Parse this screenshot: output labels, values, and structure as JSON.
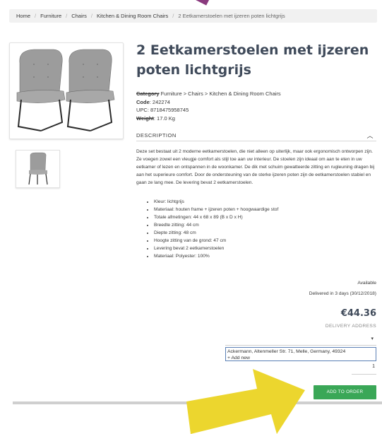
{
  "breadcrumb": {
    "items": [
      "Home",
      "Furniture",
      "Chairs",
      "Kitchen & Dining Room Chairs"
    ],
    "current": "2 Eetkamerstoelen met ijzeren poten lichtgrijs",
    "separator": "/"
  },
  "product": {
    "title": "2 Eetkamerstoelen met ijzeren poten lichtgrijs",
    "category_label": "Category",
    "category_value": " Furniture > Chairs > Kitchen & Dining Room Chairs",
    "code_label": "Code",
    "code_value": ": 242274",
    "upc_label": "UPC",
    "upc_value": ": 8718475958745",
    "weight_label": "Weight",
    "weight_value": ": 17.0 Kg"
  },
  "description": {
    "header": "DESCRIPTION",
    "toggle_icon": "chevron-up",
    "paragraph": "Deze set bestaat uit 2 moderne eetkamerstoelen, die niet alleen op uiterlijk, maar ook ergonomisch ontworpen zijn. Ze voegen zowel een vleugje comfort als stijl toe aan uw interieur. De stoelen zijn ideaal om aan te eten in uw eetkamer of lezen en ontspannen in de woonkamer. De dik met schuim gewatteerde zitting en rugleuning dragen bij aan het superieure comfort. Door de ondersteuning van de sterke ijzeren poten zijn de eetkamerstoelen stabiel en gaan ze lang mee. De levering bevat 2 eetkamerstoelen.",
    "specs": [
      "Kleur: lichtgrijs",
      "Materiaal: houten frame + ijzeren poten + hoogwaardige stof",
      "Totale afmetingen: 44 x 68 x 89 (B x D x H)",
      "Breedte zitting: 44 cm",
      "Diepte zitting: 48 cm",
      "Hoogte zitting van de grond: 47 cm",
      "Levering bevat 2 eetkamerstoelen",
      "Materiaal: Polyester: 100%"
    ]
  },
  "purchase": {
    "availability": "Available",
    "delivery_estimate": "Delivered in 3 days (30/12/2018)",
    "price": "€44.36",
    "delivery_address_label": "DELIVERY ADDRESS",
    "address_dropdown_icon": "▾",
    "address_options": [
      "Ackermann, Altenmeller Str. 71, Melle, Germany, 49324",
      "+ Add new"
    ],
    "quantity": "1",
    "add_to_order_label": "ADD TO ORDER"
  },
  "colors": {
    "accent_green": "#3aa757",
    "title_color": "#3f4a5a",
    "highlight_arrow": "#ecd62e",
    "top_arrow": "#8a3a7e"
  }
}
